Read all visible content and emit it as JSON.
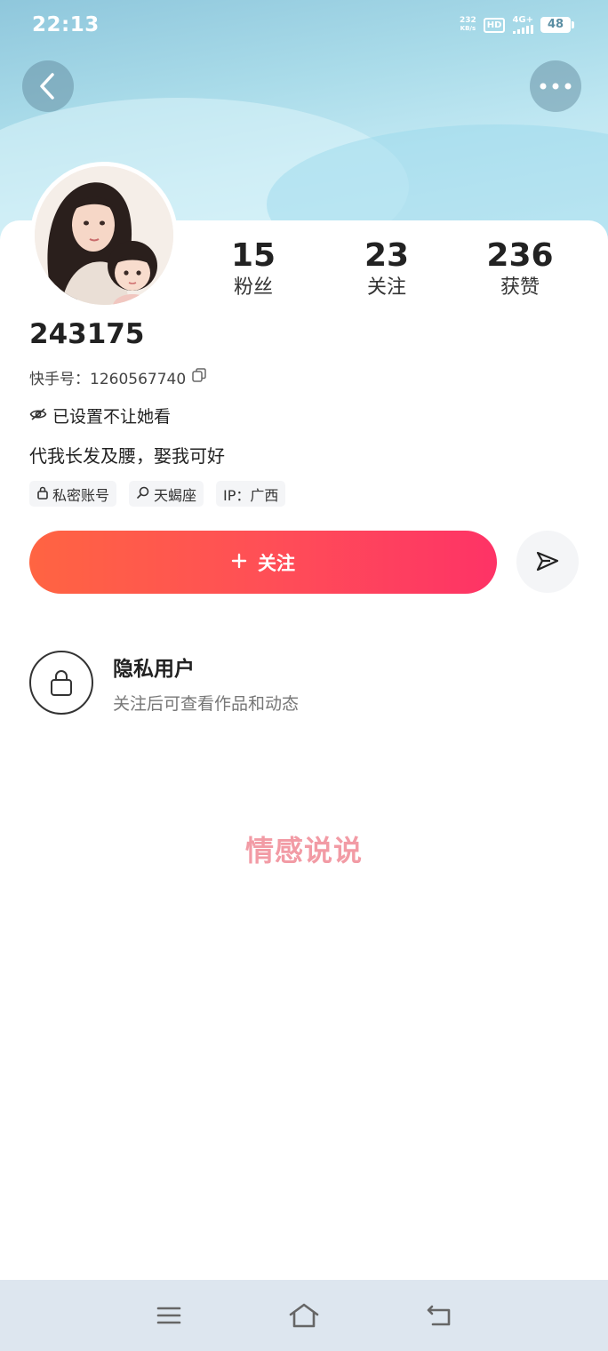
{
  "status_bar": {
    "time": "22:13",
    "net_speed_value": "232",
    "net_speed_unit": "KB/s",
    "hd": "HD",
    "network": "4G+",
    "battery": "48"
  },
  "profile": {
    "username": "243175",
    "id_label": "快手号：",
    "id_value": "1260567740",
    "hidden_notice": "已设置不让她看",
    "bio": "代我长发及腰，娶我可好",
    "stats": [
      {
        "value": "15",
        "label": "粉丝"
      },
      {
        "value": "23",
        "label": "关注"
      },
      {
        "value": "236",
        "label": "获赞"
      }
    ],
    "tags": [
      {
        "icon": "lock-icon",
        "text": "私密账号"
      },
      {
        "icon": "search-icon",
        "text": "天蝎座"
      },
      {
        "icon": "",
        "text": "IP：广西"
      }
    ]
  },
  "actions": {
    "follow_label": "关注",
    "follow_gradient": [
      "#ff6442",
      "#fe3366"
    ]
  },
  "private": {
    "title": "隐私用户",
    "subtitle": "关注后可查看作品和动态"
  },
  "watermark": "情感说说",
  "colors": {
    "header_sky": "#a9dbe9",
    "nav_bar": "#dde6ef",
    "accent": "#fe3366"
  }
}
